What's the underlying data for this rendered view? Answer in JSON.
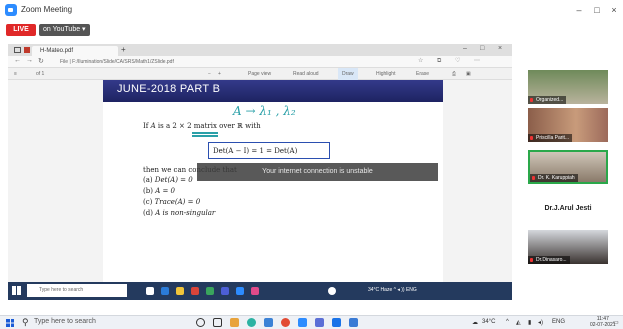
{
  "window": {
    "title": "Zoom Meeting"
  },
  "live": {
    "badge": "LIVE",
    "destination": "on YouTube ▾"
  },
  "browser": {
    "tab_label": "H-Mateo.pdf",
    "url": "File | F:/Ilumination/Slide/CA/SRS/Math1/ZSlide.pdf",
    "pdf_toolbar": {
      "page": "of 1",
      "page_view": "Page view",
      "read_aloud": "Read aloud",
      "draw": "Draw",
      "highlight": "Highlight",
      "erase": "Erase"
    }
  },
  "slide": {
    "header": "JUNE-2018 PART B",
    "ink_top": "A → λ₁ , λ₂",
    "line1_pre": "If ",
    "line1_var": "A",
    "line1_post": " is a 2 × 2 matrix over ℝ with",
    "boxed": "Det(A − I) = 1 = Det(A)",
    "line2": "then we can conclude that",
    "options": [
      {
        "label": "(a)",
        "text": "Det(A) = 0"
      },
      {
        "label": "(b)",
        "text": "A = 0"
      },
      {
        "label": "(c)",
        "text": "Trace(A) = 0"
      },
      {
        "label": "(d)",
        "text": "A is non-singular"
      }
    ]
  },
  "notification": "Your internet connection is unstable",
  "inner_taskbar": {
    "search_placeholder": "Type here to search",
    "tray": "34°C Haze  ^ ◂ ))  ENG"
  },
  "participants": [
    {
      "name": "Organized..."
    },
    {
      "name": "Priscilla Parit..."
    },
    {
      "name": "Dr. K. Karuppiah"
    },
    {
      "name": "Dr.J.Arul Jesti"
    },
    {
      "name": "Dr.Dinasaro..."
    }
  ],
  "taskbar": {
    "search_placeholder": "Type here to search",
    "weather": "34°C",
    "language": "ENG",
    "time": "11:47",
    "date": "02-07-2021"
  },
  "colors": {
    "slide_header": "#2a2f78",
    "ink": "#2aa0a8",
    "ink_box": "#2b4fb0",
    "live": "#e02828"
  }
}
